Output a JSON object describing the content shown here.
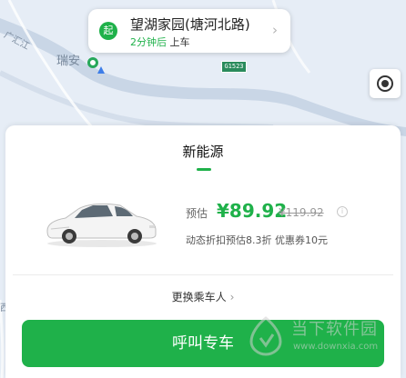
{
  "map": {
    "street_label": "广汇江",
    "area_label": "瑞安",
    "road_sign": "G1523",
    "left_edge_label": "西"
  },
  "pickup": {
    "badge": "起",
    "title": "望湖家园(塘河北路)",
    "eta": "2分钟后",
    "action": "上车"
  },
  "card": {
    "tab_title": "新能源",
    "price_label": "预估",
    "price": "¥89.92",
    "original_price": "¥119.92",
    "info_icon": "i",
    "discount_text": "动态折扣预估8.3折  优惠券10元",
    "change_rider": "更换乘车人",
    "call_button": "呼叫专车"
  },
  "watermark": {
    "text": "当下软件园",
    "url": "www.downxia.com"
  },
  "colors": {
    "accent": "#1fb14a",
    "map_bg": "#e6edf6",
    "river": "#c9d6e6"
  }
}
